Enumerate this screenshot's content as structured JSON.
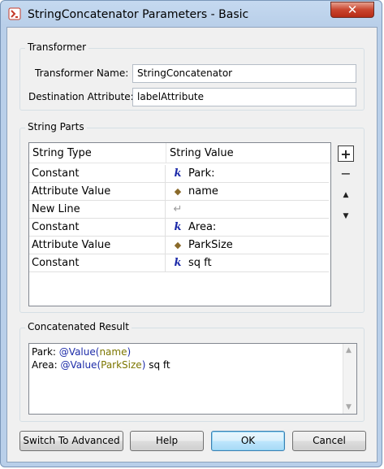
{
  "window": {
    "title": "StringConcatenator Parameters - Basic",
    "close_label": "✕"
  },
  "transformer": {
    "group_title": "Transformer",
    "name_label": "Transformer Name:",
    "name_value": "StringConcatenator",
    "dest_label": "Destination Attribute:",
    "dest_value": "labelAttribute"
  },
  "string_parts": {
    "group_title": "String Parts",
    "columns": [
      "String Type",
      "String Value"
    ],
    "rows": [
      {
        "type": "Constant",
        "icon": "constant-icon",
        "value": "Park:"
      },
      {
        "type": "Attribute Value",
        "icon": "attribute-icon",
        "value": "name"
      },
      {
        "type": "New Line",
        "icon": "newline-icon",
        "value": ""
      },
      {
        "type": "Constant",
        "icon": "constant-icon",
        "value": "Area:"
      },
      {
        "type": "Attribute Value",
        "icon": "attribute-icon",
        "value": "ParkSize"
      },
      {
        "type": "Constant",
        "icon": "constant-icon",
        "value": "sq ft"
      }
    ],
    "add_label": "+",
    "remove_label": "−",
    "up_label": "▲",
    "down_label": "▼"
  },
  "result": {
    "group_title": "Concatenated Result",
    "line1": {
      "prefix": "Park: ",
      "fn": "@Value(",
      "arg": "name",
      "close": ")"
    },
    "line2": {
      "prefix": "Area: ",
      "fn": "@Value(",
      "arg": "ParkSize",
      "close": ")",
      "suffix": " sq ft"
    }
  },
  "buttons": {
    "advanced": "Switch To Advanced",
    "help": "Help",
    "ok": "OK",
    "cancel": "Cancel"
  },
  "colors": {
    "constant_icon": "#1a28a8",
    "attribute_icon": "#8a6a2a",
    "function": "#1c2ba8",
    "attribute_arg": "#7c7600",
    "close_button": "#c9452e"
  }
}
